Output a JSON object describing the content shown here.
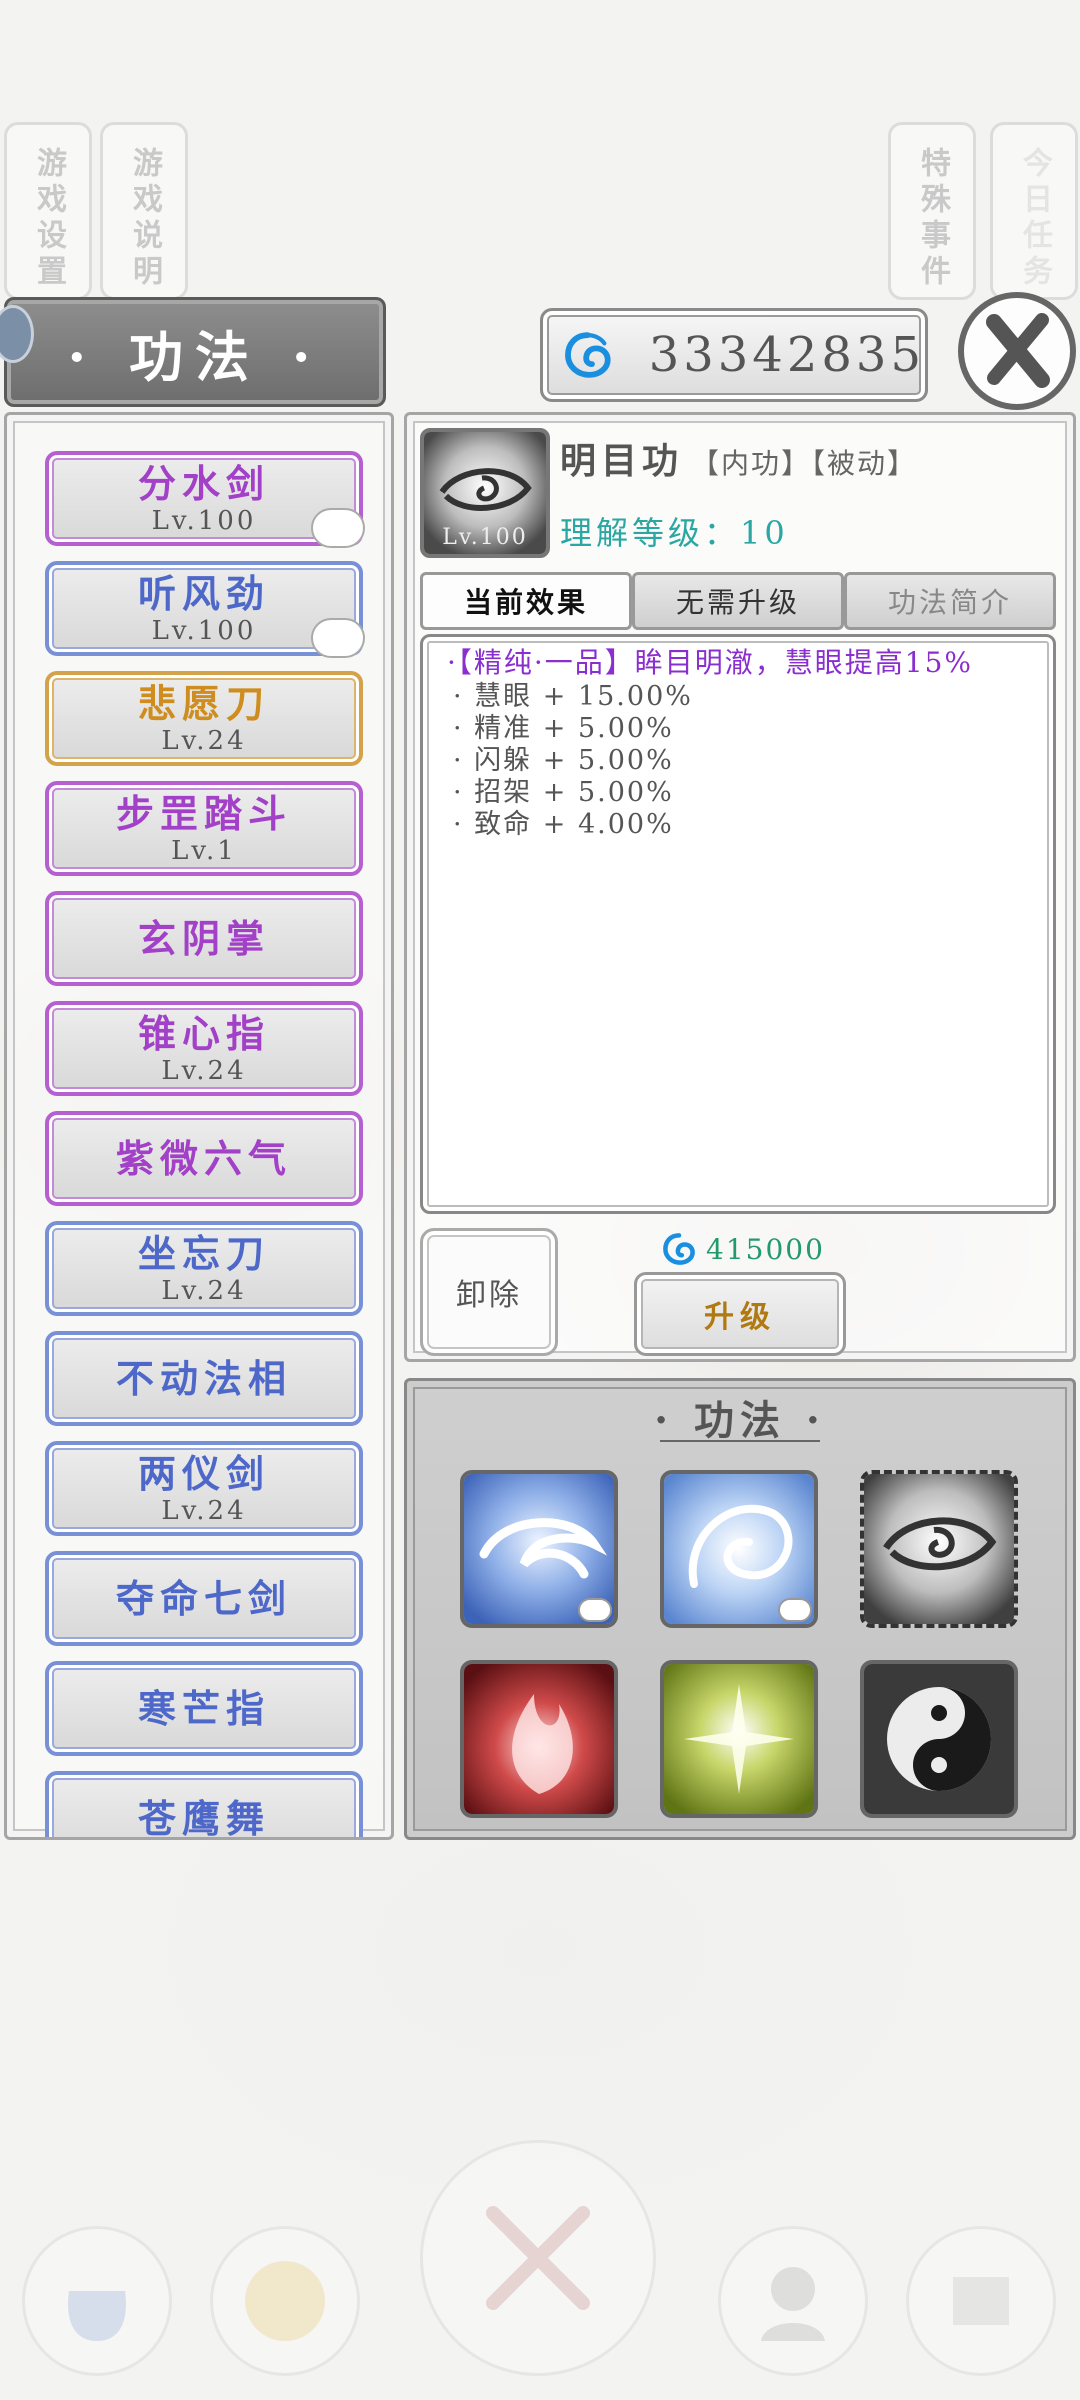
{
  "top_tabs": [
    {
      "label": "游戏设置"
    },
    {
      "label": "游戏说明"
    },
    {
      "label": "特殊事件"
    },
    {
      "label": "今日任务"
    }
  ],
  "title": "· 功法 ·",
  "currency": {
    "value": "33342835",
    "icon": "spirit-coin-icon",
    "color": "#1a8fe0"
  },
  "skill_list": [
    {
      "name": "分水剑",
      "level": "Lv.100",
      "color": "purple"
    },
    {
      "name": "听风劲",
      "level": "Lv.100",
      "color": "blue"
    },
    {
      "name": "悲愿刀",
      "level": "Lv.24",
      "color": "orange"
    },
    {
      "name": "步罡踏斗",
      "level": "Lv.1",
      "color": "purple"
    },
    {
      "name": "玄阴掌",
      "level": "",
      "color": "purple"
    },
    {
      "name": "锥心指",
      "level": "Lv.24",
      "color": "purple"
    },
    {
      "name": "紫微六气",
      "level": "",
      "color": "purple"
    },
    {
      "name": "坐忘刀",
      "level": "Lv.24",
      "color": "blue"
    },
    {
      "name": "不动法相",
      "level": "",
      "color": "blue"
    },
    {
      "name": "两仪剑",
      "level": "Lv.24",
      "color": "blue"
    },
    {
      "name": "夺命七剑",
      "level": "",
      "color": "blue"
    },
    {
      "name": "寒芒指",
      "level": "",
      "color": "blue"
    },
    {
      "name": "苍鹰舞",
      "level": "",
      "color": "blue"
    }
  ],
  "detail": {
    "icon_level": "Lv.100",
    "name": "明目功",
    "tags": "【内功】【被动】",
    "understanding": "理解等级：10",
    "tabs": [
      "当前效果",
      "无需升级",
      "功法简介"
    ],
    "main_effect": "·【精纯·一品】眸目明澈，慧眼提高15%",
    "stats": [
      "· 慧眼 + 15.00%",
      "· 精准 + 5.00%",
      "· 闪躲 + 5.00%",
      "· 招架 + 5.00%",
      "· 致命 + 4.00%"
    ],
    "unequip_label": "卸除",
    "cost": "415000",
    "upgrade_label": "升级"
  },
  "equipped": {
    "title": "· 功法 ·",
    "slots": [
      "wind-blade-icon",
      "whirlwind-icon",
      "eye-icon",
      "crimson-flame-icon",
      "radiant-leaf-icon",
      "yin-yang-icon"
    ]
  },
  "nav": [
    "bag-icon",
    "coin-icon",
    "battle-icon",
    "character-icon",
    "scroll-icon"
  ]
}
